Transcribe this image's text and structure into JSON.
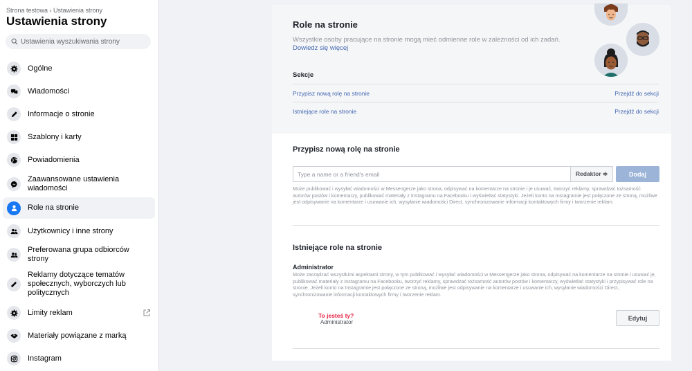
{
  "sidebar": {
    "breadcrumb": "Strona testowa › Ustawienia strony",
    "title": "Ustawienia strony",
    "search_placeholder": "Ustawienia wyszukiwania strony",
    "items": [
      {
        "label": "Ogólne",
        "icon": "gear-icon"
      },
      {
        "label": "Wiadomości",
        "icon": "chat-bubbles-icon"
      },
      {
        "label": "Informacje o stronie",
        "icon": "pencil-icon"
      },
      {
        "label": "Szablony i karty",
        "icon": "grid-icon"
      },
      {
        "label": "Powiadomienia",
        "icon": "globe-icon"
      },
      {
        "label": "Zaawansowane ustawienia wiadomości",
        "icon": "messenger-icon"
      },
      {
        "label": "Role na stronie",
        "icon": "person-icon"
      },
      {
        "label": "Użytkownicy i inne strony",
        "icon": "people-icon"
      },
      {
        "label": "Preferowana grupa odbiorców strony",
        "icon": "people-icon"
      },
      {
        "label": "Reklamy dotyczące tematów społecznych, wyborczych lub politycznych",
        "icon": "megaphone-icon"
      },
      {
        "label": "Limity reklam",
        "icon": "gear-icon"
      },
      {
        "label": "Materiały powiązane z marką",
        "icon": "handshake-icon"
      },
      {
        "label": "Instagram",
        "icon": "instagram-icon"
      }
    ]
  },
  "roles": {
    "title": "Role na stronie",
    "description": "Wszystkie osoby pracujące na stronie mogą mieć odmienne role w zależności od ich zadań.",
    "learn_more": "Dowiedz się więcej",
    "sections_label": "Sekcje",
    "sections": [
      {
        "label": "Przypisz nową rolę na stronie",
        "action": "Przejdź do sekcji"
      },
      {
        "label": "Istniejące role na stronie",
        "action": "Przejdź do sekcji"
      }
    ]
  },
  "assign": {
    "title": "Przypisz nową rolę na stronie",
    "input_placeholder": "Type a name or a friend's email",
    "role_selected": "Redaktor ≑",
    "add_label": "Dodaj",
    "description": "Może publikować i wysyłać wiadomości w Messengerze jako strona, odpisywać na komentarze na stronie i je usuwać, tworzyć reklamy, sprawdzać tożsamość autorów postów i komentarzy, publikować materiały z Instagramu na Facebooku i wyświetlać statystyki. Jeżeli konto na Instagramie jest połączone ze stroną, możliwe jest odpisywanie na komentarze i usuwanie ich, wysyłanie wiadomości Direct, synchronizowanie informacji kontaktowych firmy i tworzenie reklam."
  },
  "existing": {
    "title": "Istniejące role na stronie",
    "role_title": "Administrator",
    "role_description": "Może zarządzać wszystkimi aspektami strony, w tym publikować i wysyłać wiadomości w Messengerze jako strona, odpisywać na komentarze na stronie i usuwać je, publikować materiały z Instagramu na Facebooku, tworzyć reklamy, sprawdzać tożsamość autorów postów i komentarzy, wyświetlać statystyki i przypisywać role na stronie. Jeżeli konto na Instagramie jest połączone ze stroną, możliwe jest odpisywanie na komentarze i usuwanie ich, wysyłanie wiadomości Direct, synchronizowanie informacji kontaktowych firmy i tworzenie reklam.",
    "you_label": "To jesteś ty?",
    "you_role": "Administrator",
    "edit_label": "Edytuj"
  },
  "colors": {
    "accent": "#1877f2",
    "link": "#4267b2",
    "danger": "#e41e3f"
  }
}
